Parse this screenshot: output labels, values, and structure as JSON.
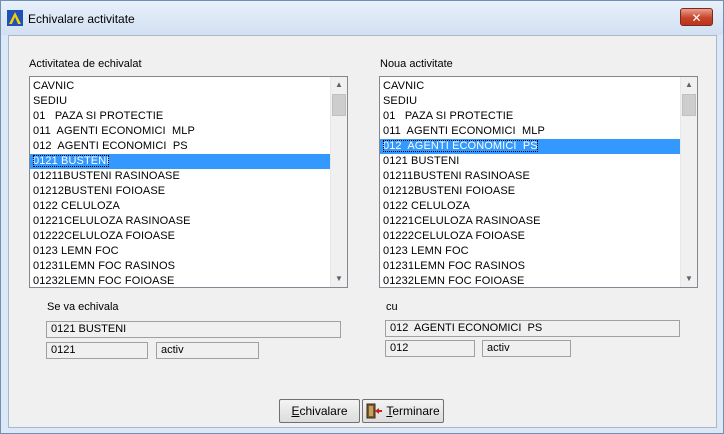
{
  "window": {
    "title": "Echivalare activitate",
    "close_label": "✕"
  },
  "left_panel": {
    "label": "Activitatea de echivalat",
    "selected_index": 5,
    "items": [
      "CAVNIC",
      "SEDIU",
      "01   PAZA SI PROTECTIE",
      "011  AGENTI ECONOMICI  MLP",
      "012  AGENTI ECONOMICI  PS",
      "0121 BUSTENI",
      "01211BUSTENI RASINOASE",
      "01212BUSTENI FOIOASE",
      "0122 CELULOZA",
      "01221CELULOZA RASINOASE",
      "01222CELULOZA FOIOASE",
      "0123 LEMN FOC",
      "01231LEMN FOC RASINOS",
      "01232LEMN FOC FOIOASE"
    ]
  },
  "right_panel": {
    "label": "Noua activitate",
    "selected_index": 4,
    "items": [
      "CAVNIC",
      "SEDIU",
      "01   PAZA SI PROTECTIE",
      "011  AGENTI ECONOMICI  MLP",
      "012  AGENTI ECONOMICI  PS",
      "0121 BUSTENI",
      "01211BUSTENI RASINOASE",
      "01212BUSTENI FOIOASE",
      "0122 CELULOZA",
      "01221CELULOZA RASINOASE",
      "01222CELULOZA FOIOASE",
      "0123 LEMN FOC",
      "01231LEMN FOC RASINOS",
      "01232LEMN FOC FOIOASE"
    ]
  },
  "source": {
    "label": "Se va echivala",
    "name": "0121 BUSTENI",
    "code": "0121",
    "status": "activ"
  },
  "target": {
    "label": "cu",
    "name": "012  AGENTI ECONOMICI  PS",
    "code": "012",
    "status": "activ"
  },
  "buttons": {
    "echivalare_first": "E",
    "echivalare_rest": "chivalare",
    "terminare_first": "T",
    "terminare_rest": "erminare"
  }
}
